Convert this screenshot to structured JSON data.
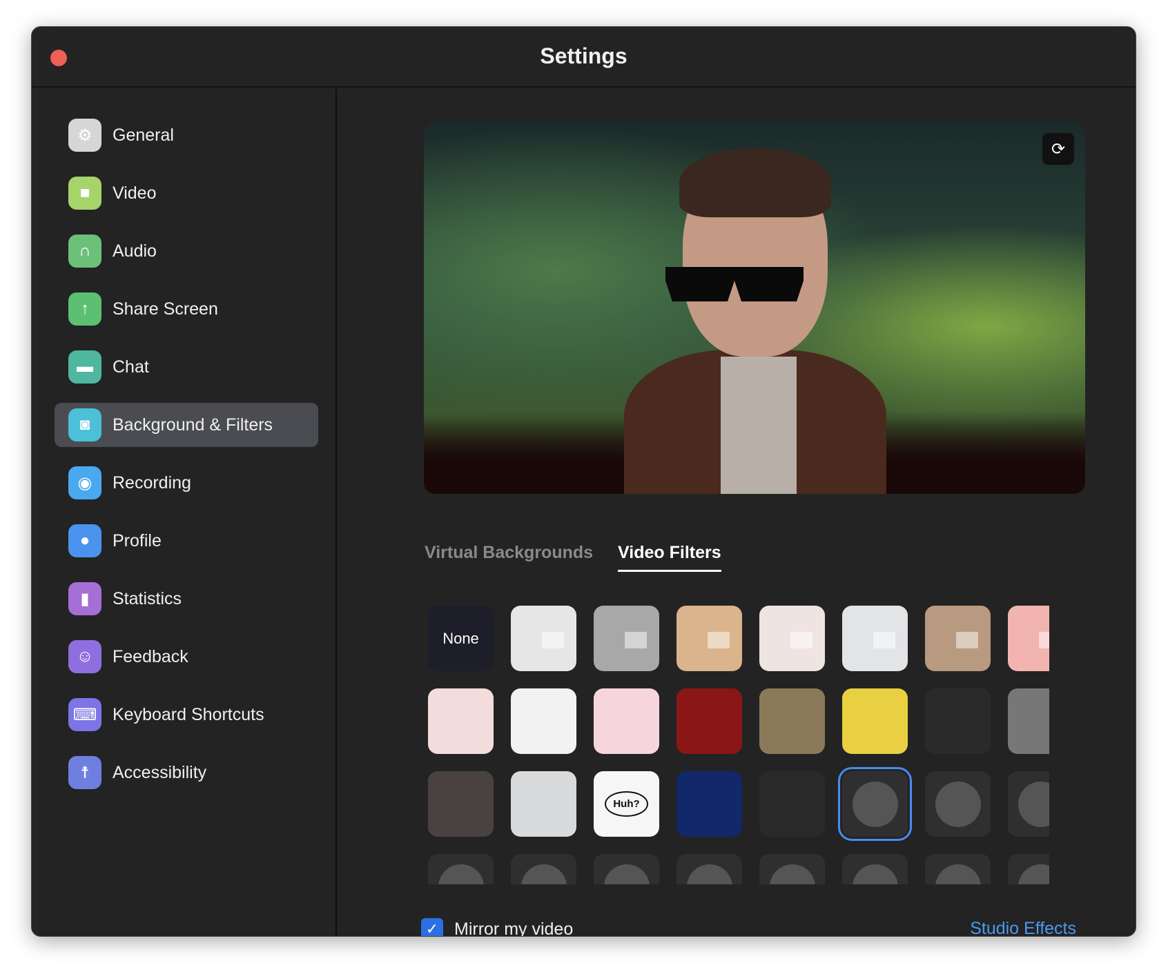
{
  "window": {
    "title": "Settings"
  },
  "sidebar": {
    "items": [
      {
        "label": "General",
        "icon": "gear-icon",
        "color": "#d6d6d6"
      },
      {
        "label": "Video",
        "icon": "video-camera-icon",
        "color": "#a6d36a"
      },
      {
        "label": "Audio",
        "icon": "headphones-icon",
        "color": "#6cc07a"
      },
      {
        "label": "Share Screen",
        "icon": "share-screen-icon",
        "color": "#5cbf72"
      },
      {
        "label": "Chat",
        "icon": "chat-bubble-icon",
        "color": "#4fb6a0"
      },
      {
        "label": "Background & Filters",
        "icon": "background-person-icon",
        "color": "#4cc0d8",
        "selected": true
      },
      {
        "label": "Recording",
        "icon": "record-icon",
        "color": "#4aa8ef"
      },
      {
        "label": "Profile",
        "icon": "person-icon",
        "color": "#4a94ef"
      },
      {
        "label": "Statistics",
        "icon": "bar-chart-icon",
        "color": "#a56fd6"
      },
      {
        "label": "Feedback",
        "icon": "smiley-icon",
        "color": "#8f6fe0"
      },
      {
        "label": "Keyboard Shortcuts",
        "icon": "keyboard-icon",
        "color": "#7d74e6"
      },
      {
        "label": "Accessibility",
        "icon": "accessibility-icon",
        "color": "#6e7fe0"
      }
    ]
  },
  "tabs": [
    {
      "label": "Virtual Backgrounds",
      "active": false
    },
    {
      "label": "Video Filters",
      "active": true
    }
  ],
  "filters": {
    "none_label": "None",
    "huh_label": "Huh?",
    "selected_index": 21
  },
  "mirror": {
    "label": "Mirror my video",
    "checked": true
  },
  "studio_effects": "Studio Effects",
  "accent": "#4a8cf0"
}
